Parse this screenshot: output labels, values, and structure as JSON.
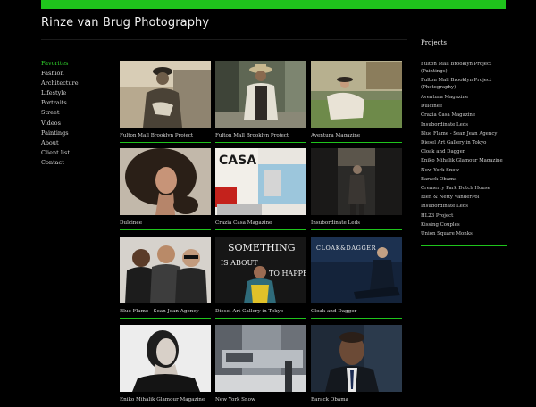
{
  "site": {
    "title": "Rinze van Brug Photography"
  },
  "nav": {
    "items": [
      {
        "label": "Favorites",
        "active": true
      },
      {
        "label": "Fashion"
      },
      {
        "label": "Architecture"
      },
      {
        "label": "Lifestyle"
      },
      {
        "label": "Portraits"
      },
      {
        "label": "Street"
      },
      {
        "label": "Videos"
      },
      {
        "label": "Paintings"
      },
      {
        "label": "About"
      },
      {
        "label": "Client list"
      },
      {
        "label": "Contact"
      }
    ]
  },
  "gallery": {
    "items": [
      {
        "caption": "Fulton Mall Brooklyn Project",
        "photo": "tinted-portrait-man-hat"
      },
      {
        "caption": "Fulton Mall Brooklyn Project",
        "photo": "man-hat-street"
      },
      {
        "caption": "Aventura Magazine",
        "photo": "woman-on-grass"
      },
      {
        "caption": "Dulcinee",
        "photo": "curly-hair-woman"
      },
      {
        "caption": "Crazia Casa Magazine",
        "photo": "casa-magazine-cover"
      },
      {
        "caption": "Insubordinate Leds",
        "photo": "dark-alley-figure"
      },
      {
        "caption": "Blue Flame - Sean Jean Agency",
        "photo": "three-models"
      },
      {
        "caption": "Diesel Art Gallery in Tokyo",
        "photo": "something-is-about-to-happen"
      },
      {
        "caption": "Cloak and Dagger",
        "photo": "cloak-dagger-ad",
        "overlay": "CLOAK&DAGGER"
      },
      {
        "caption": "Eniko Mihalik Glamour Magazine",
        "photo": "bw-woman-portrait"
      },
      {
        "caption": "New York Snow",
        "photo": "snowy-street"
      },
      {
        "caption": "Barack Obama",
        "photo": "obama-portrait"
      }
    ],
    "casa_text": "CASA",
    "something_text": [
      "SOMETHING",
      "IS ABOUT",
      "TO HAPPEN"
    ]
  },
  "projects": {
    "heading": "Projects",
    "items": [
      "Fulton Mall Brooklyn Project (Paintings)",
      "Fulton Mall Brooklyn Project (Photography)",
      "Aventura Magazine",
      "Dulcinee",
      "Crazia Casa Magazine",
      "Insubordinate Leds",
      "Blue Flame - Sean Jean Agency",
      "Diesel Art Gallery in Tokyo",
      "Cloak and Dagger",
      "Eniko Mihalik Glamour Magazine",
      "New York Snow",
      "Barack Obama",
      "Cremerry Park Dutch House",
      "Rien & Netty VanderPol",
      "Insubordinate Leds",
      "HL23 Project",
      "Kissing Couples",
      "Union Square Monks"
    ]
  },
  "colors": {
    "accent": "#1fc41c",
    "background": "#000000"
  }
}
